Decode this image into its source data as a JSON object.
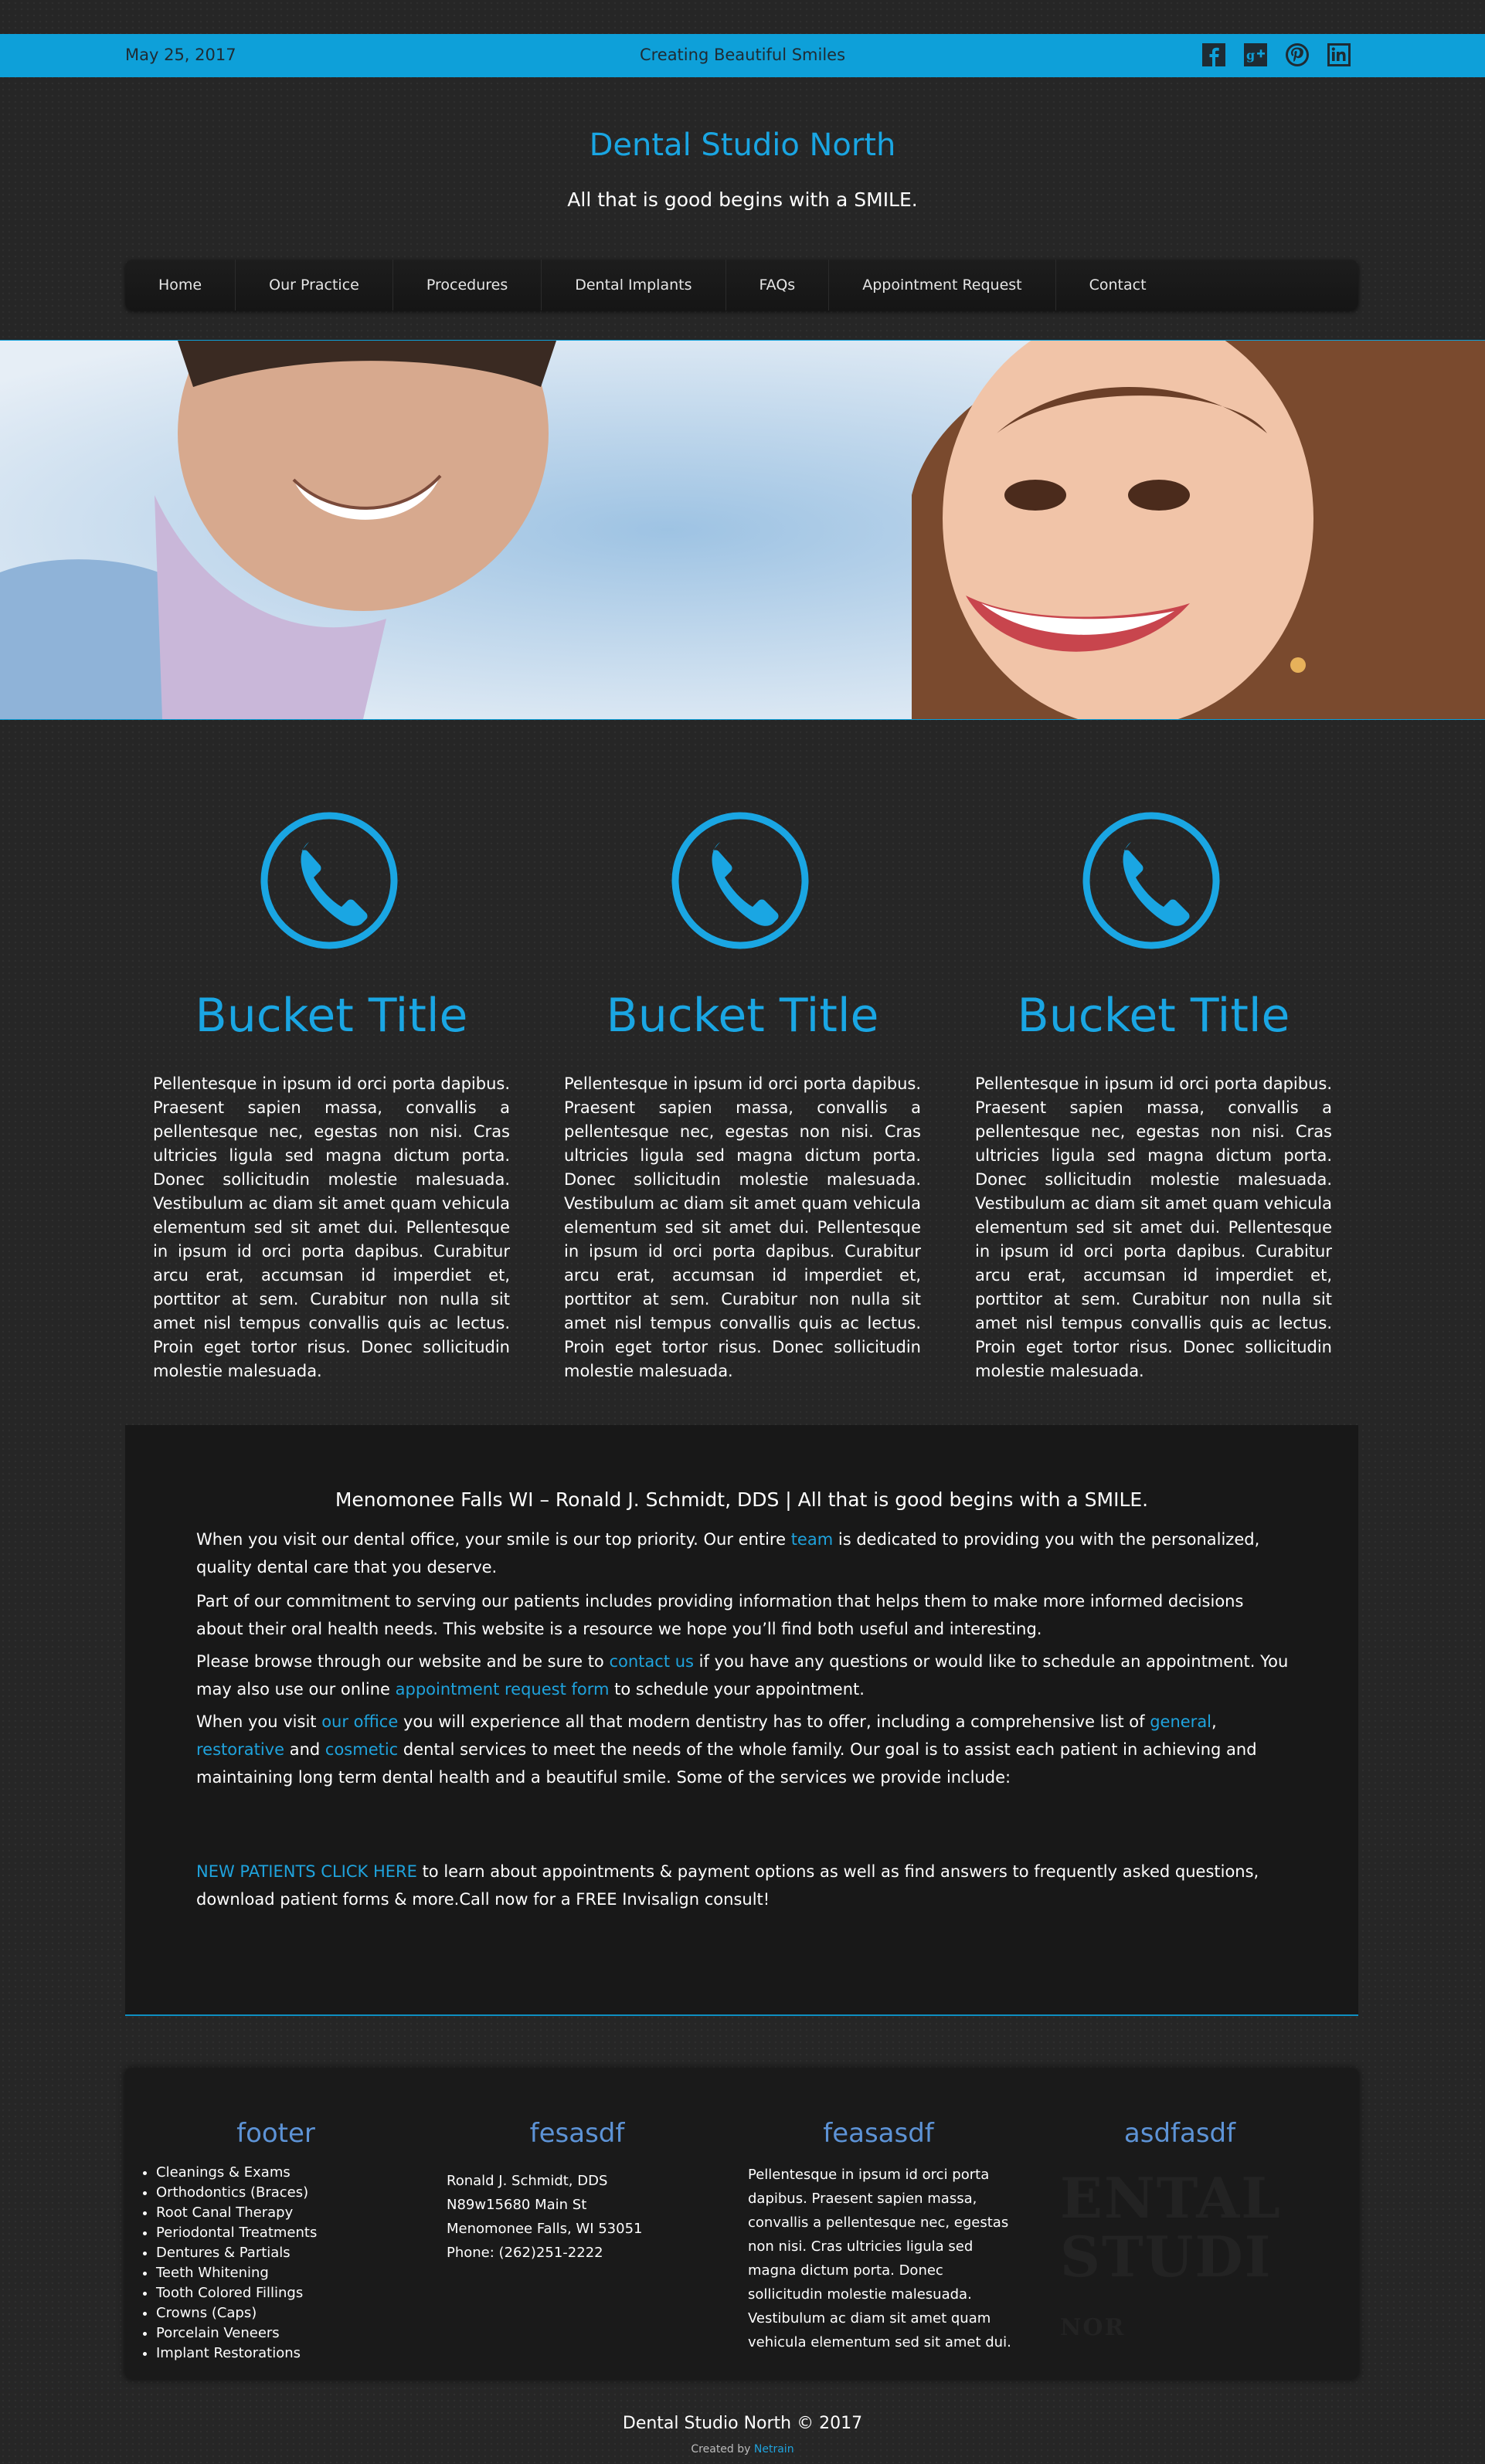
{
  "topbar": {
    "date": "May 25, 2017",
    "tagline": "Creating Beautiful Smiles",
    "social": [
      "facebook-icon",
      "google-plus-icon",
      "pinterest-icon",
      "linkedin-icon"
    ]
  },
  "header": {
    "title": "Dental Studio North",
    "subtitle": "All that is good begins with a SMILE."
  },
  "nav": {
    "items": [
      "Home",
      "Our Practice",
      "Procedures",
      "Dental Implants",
      "FAQs",
      "Appointment Request",
      "Contact"
    ]
  },
  "buckets": [
    {
      "title": "Bucket Title",
      "text": "Pellentesque in ipsum id orci porta dapibus. Praesent sapien massa, convallis a pellentesque nec, egestas non nisi. Cras ultricies ligula sed magna dictum porta. Donec sollicitudin molestie malesuada. Vestibulum ac diam sit amet quam vehicula elementum sed sit amet dui. Pellentesque in ipsum id orci porta dapibus. Curabitur arcu erat, accumsan id imperdiet et, porttitor at sem. Curabitur non nulla sit amet nisl tempus convallis quis ac lectus. Proin eget tortor risus. Donec sollicitudin molestie malesuada."
    },
    {
      "title": "Bucket Title",
      "text": "Pellentesque in ipsum id orci porta dapibus. Praesent sapien massa, convallis a pellentesque nec, egestas non nisi. Cras ultricies ligula sed magna dictum porta. Donec sollicitudin molestie malesuada. Vestibulum ac diam sit amet quam vehicula elementum sed sit amet dui. Pellentesque in ipsum id orci porta dapibus. Curabitur arcu erat, accumsan id imperdiet et, porttitor at sem. Curabitur non nulla sit amet nisl tempus convallis quis ac lectus. Proin eget tortor risus. Donec sollicitudin molestie malesuada."
    },
    {
      "title": "Bucket Title",
      "text": "Pellentesque in ipsum id orci porta dapibus. Praesent sapien massa, convallis a pellentesque nec, egestas non nisi. Cras ultricies ligula sed magna dictum porta. Donec sollicitudin molestie malesuada. Vestibulum ac diam sit amet quam vehicula elementum sed sit amet dui. Pellentesque in ipsum id orci porta dapibus. Curabitur arcu erat, accumsan id imperdiet et, porttitor at sem. Curabitur non nulla sit amet nisl tempus convallis quis ac lectus. Proin eget tortor risus. Donec sollicitudin molestie malesuada."
    }
  ],
  "content": {
    "heading": "Menomonee Falls WI – Ronald J. Schmidt, DDS  |  All that is good begins with a SMILE.",
    "p1_a": "When you visit our dental office, your smile is our top priority.  Our entire ",
    "p1_link": "team",
    "p1_b": " is dedicated to providing you with the personalized, quality dental care that you deserve.",
    "p2": "Part of our commitment to serving our patients includes providing information that helps them to make more informed decisions about their oral health needs.  This website is a resource we hope you’ll find both useful and interesting.",
    "p3_a": "Please browse through our website and be sure to ",
    "p3_link1": "contact us",
    "p3_b": " if you have any questions or would like to schedule an appointment. You may also use our online ",
    "p3_link2": "appointment request form",
    "p3_c": " to schedule your appointment.",
    "p4_a": "When you visit ",
    "p4_link1": "our office",
    "p4_b": " you will experience all that modern dentistry has to offer, including a comprehensive list of ",
    "p4_link2": "general",
    "p4_c": ", ",
    "p4_link3": "restorative",
    "p4_d": " and ",
    "p4_link4": "cosmetic",
    "p4_e": " dental services to meet the  needs of  the whole family. Our goal is to assist each patient in achieving and maintaining long term dental health and a beautiful smile. Some of the services we provide include:",
    "p5_link": "NEW PATIENTS CLICK HERE",
    "p5_b": " to learn about appointments & payment options as well as find answers to frequently asked questions, download patient forms & more.Call now for a FREE Invisalign consult!"
  },
  "footer": {
    "col1": {
      "title": "footer",
      "items": [
        "Cleanings & Exams",
        "Orthodontics (Braces)",
        "Root Canal Therapy",
        "Periodontal Treatments",
        "Dentures & Partials",
        "Teeth Whitening",
        "Tooth Colored Fillings",
        "Crowns (Caps)",
        "Porcelain Veneers",
        "Implant Restorations"
      ]
    },
    "col2": {
      "title": "fesasdf",
      "lines": [
        "Ronald J. Schmidt, DDS",
        "N89w15680 Main St",
        "Menomonee Falls, WI 53051",
        "Phone: (262)251-2222"
      ]
    },
    "col3": {
      "title": "feasasdf",
      "text": "Pellentesque in ipsum id orci porta dapibus. Praesent sapien massa, convallis a pellentesque nec, egestas non nisi. Cras ultricies ligula sed magna dictum porta. Donec sollicitudin molestie malesuada. Vestibulum ac diam sit amet quam vehicula elementum sed sit amet dui."
    },
    "col4": {
      "title": "asdfasdf"
    },
    "copyright": "Dental Studio North © 2017",
    "created_prefix": "Created by ",
    "created_link": "Netrain"
  },
  "colors": {
    "accent": "#1aa6e3",
    "topbar": "#0ea0d9",
    "footer_heading": "#5d93d6"
  }
}
